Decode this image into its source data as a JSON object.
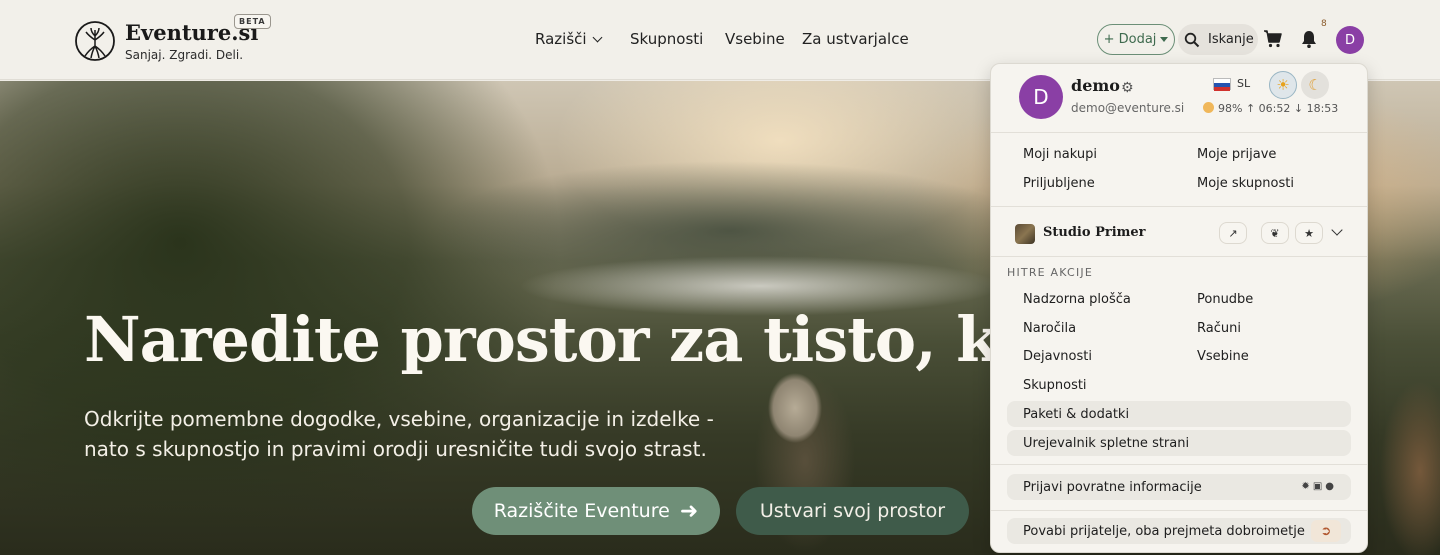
{
  "header": {
    "brand": "Eventure.si",
    "beta": "BETA",
    "tagline": "Sanjaj. Zgradi. Deli.",
    "nav": {
      "explore": "Razišči",
      "communities": "Skupnosti",
      "contents": "Vsebine",
      "creators": "Za ustvarjalce"
    },
    "add_label": "+ Dodaj",
    "search_label": "Iskanje",
    "notification_count": "8",
    "avatar_initial": "D",
    "icons": [
      "tree-logo-icon",
      "chevron-down-icon",
      "search-icon",
      "cart-icon",
      "bell-icon"
    ]
  },
  "hero": {
    "title": "Naredite prostor za tisto, kar va",
    "subtitle": "Odkrijte pomembne dogodke, vsebine, organizacije in izdelke - nato s skupnostjo in pravimi orodji uresničite tudi svojo strast.",
    "primary_button": "Raziščite Eventure",
    "secondary_button": "Ustvari svoj prostor"
  },
  "user_menu": {
    "avatar_initial": "D",
    "username": "demo",
    "email": "demo@eventure.si",
    "language": "SL",
    "weather": "98% ↑ 06:52 ↓ 18:53",
    "links": [
      "Moji nakupi",
      "Moje prijave",
      "Priljubljene",
      "Moje skupnosti"
    ],
    "studio_name": "Studio Primer",
    "quick_actions_title": "HITRE AKCIJE",
    "quick_actions": [
      "Nadzorna plošča",
      "Ponudbe",
      "Naročila",
      "Računi",
      "Dejavnosti",
      "Vsebine",
      "Skupnosti"
    ],
    "packages": "Paketi & dodatki",
    "site_editor": "Urejevalnik spletne strani",
    "feedback": "Prijavi povratne informacije",
    "invite": "Povabi prijatelje, oba prejmeta dobroimetje",
    "icons": [
      "gear-icon",
      "slovenia-flag-icon",
      "sun-icon",
      "moon-icon",
      "external-link-icon",
      "sprout-icon",
      "star-icon",
      "chevron-down-icon",
      "bug-icon",
      "camera-icon",
      "lightbulb-icon",
      "logout-icon"
    ]
  },
  "colors": {
    "primary_green": "#6f8f78",
    "dark_green": "#3f5b4a",
    "avatar_purple": "#8a3fa5",
    "header_bg": "#f2f0ea"
  }
}
